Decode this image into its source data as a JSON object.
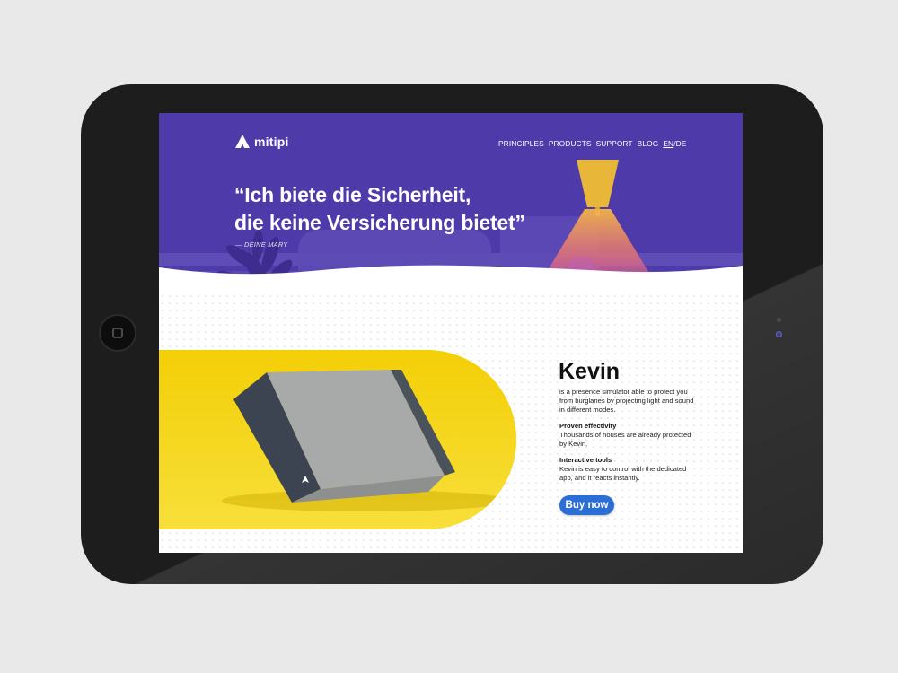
{
  "device": {
    "colors": {
      "frame": "#1d1d1d",
      "background": "#e9e9e9"
    },
    "icons": {
      "home_button": "home-button-icon",
      "camera": "camera-icon"
    }
  },
  "site": {
    "brand": "mitipi",
    "logo_icon": "mitipi-logo-icon",
    "colors": {
      "hero_bg": "#4f3aaa",
      "accent_yellow": "#f6d000",
      "button_blue": "#2a6ed6",
      "lamp": "#e8b73a"
    }
  },
  "nav": {
    "items": [
      {
        "label": "PRINCIPLES"
      },
      {
        "label": "PRODUCTS"
      },
      {
        "label": "SUPPORT"
      },
      {
        "label": "BLOG"
      }
    ],
    "lang_active": "EN",
    "lang_separator": "/",
    "lang_other": "DE"
  },
  "hero": {
    "quote_line1": "“Ich biete die Sicherheit,",
    "quote_line2": "die keine Versicherung bietet”",
    "attribution": "— DEINE MARY"
  },
  "product": {
    "name": "Kevin",
    "intro": "is a presence simulator able to protect you from burglaries by projecting light and sound in different modes.",
    "feature1_title": "Proven effectivity",
    "feature1_text": "Thousands of houses are already protected by Kevin.",
    "feature2_title": "Interactive tools",
    "feature2_text": "Kevin is easy to control with the dedicated app, and it reacts instantly.",
    "buy_label": "Buy now"
  }
}
